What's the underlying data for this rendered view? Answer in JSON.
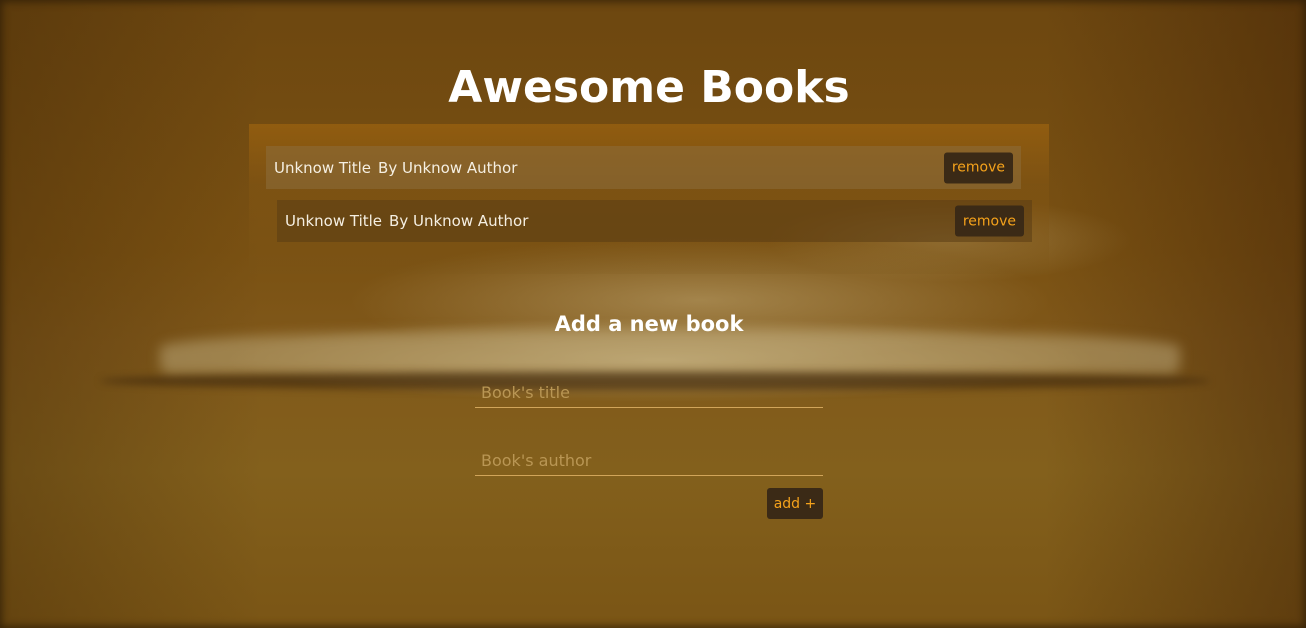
{
  "page": {
    "title": "Awesome Books"
  },
  "books": [
    {
      "title": "Unknow Title",
      "author": "By Unknow Author",
      "remove_label": "remove"
    },
    {
      "title": "Unknow Title",
      "author": "By Unknow Author",
      "remove_label": "remove"
    }
  ],
  "form": {
    "heading": "Add a new book",
    "title_placeholder": "Book's title",
    "author_placeholder": "Book's author",
    "title_value": "",
    "author_value": "",
    "add_label": "add +"
  },
  "colors": {
    "accent": "#f5a21b",
    "button_bg": "#3b2a16",
    "text": "#ffffff"
  }
}
